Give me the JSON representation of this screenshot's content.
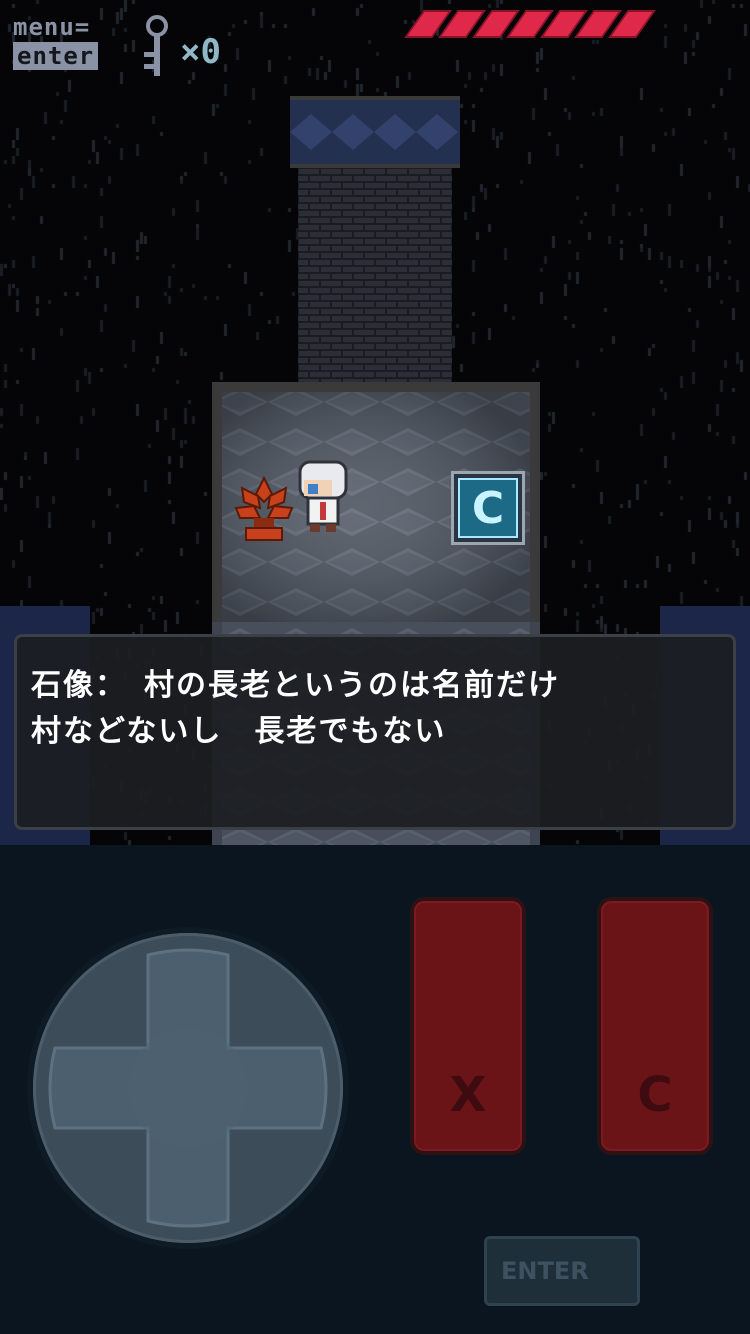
{
  "hud": {
    "menu_label": "menu=",
    "enter_label": "enter",
    "key_count": "×0",
    "health_segments": 7,
    "health_color": "#e0294a"
  },
  "scene": {
    "floor_color": "#4e5563",
    "wall_color": "#2a3557",
    "block_label": "C"
  },
  "dialog": {
    "line1": "石像：　村の長老というのは名前だけ",
    "line2": "村などないし　長老でもない"
  },
  "controls": {
    "dpad": "dpad-icon",
    "x_button_label": "X",
    "c_button_label": "C",
    "enter_button_label": "ENTER",
    "button_color": "#6b1418"
  }
}
